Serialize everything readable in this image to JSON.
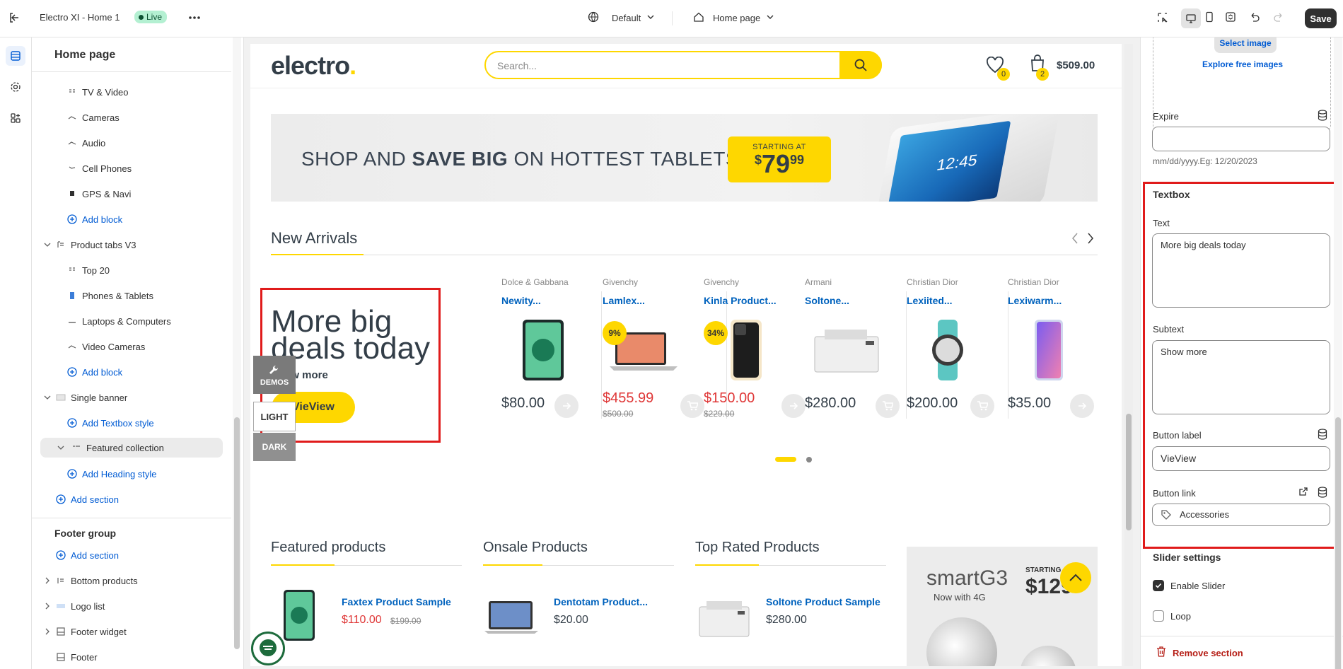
{
  "topbar": {
    "store_name": "Electro XI - Home 1",
    "status": "Live",
    "theme_select": "Default",
    "page_select": "Home page",
    "save_label": "Save"
  },
  "tree": {
    "title": "Home page",
    "items": [
      {
        "label": "TV & Video"
      },
      {
        "label": "Cameras"
      },
      {
        "label": "Audio"
      },
      {
        "label": "Cell Phones"
      },
      {
        "label": "GPS & Navi"
      },
      {
        "label": "Add block"
      },
      {
        "label": "Product tabs V3"
      },
      {
        "label": "Top 20"
      },
      {
        "label": "Phones & Tablets"
      },
      {
        "label": "Laptops & Computers"
      },
      {
        "label": "Video Cameras"
      },
      {
        "label": "Add block"
      },
      {
        "label": "Single banner"
      },
      {
        "label": "Add Textbox style"
      },
      {
        "label": "Featured collection"
      },
      {
        "label": "Add Heading style"
      },
      {
        "label": "Add section"
      }
    ],
    "footer_group": "Footer group",
    "footer_items": [
      {
        "label": "Add section"
      },
      {
        "label": "Bottom products"
      },
      {
        "label": "Logo list"
      },
      {
        "label": "Footer widget"
      },
      {
        "label": "Footer"
      }
    ]
  },
  "preview": {
    "logo": "electro",
    "logo_dot": ".",
    "search_placeholder": "Search...",
    "wishlist_count": "0",
    "cart_count": "2",
    "cart_total": "$509.00",
    "banner": {
      "text_pre": "SHOP AND ",
      "text_bold": "SAVE BIG",
      "text_post": " ON HOTTEST TABLETS",
      "starting_at": "STARTING AT",
      "price_cur": "$",
      "price_main": "79",
      "price_cents": "99",
      "tablet_time": "12:45"
    },
    "new_arrivals": "New Arrivals",
    "promo": {
      "text": "More big deals today",
      "subtext": "Show more",
      "button": "VieView"
    },
    "floaters": {
      "demos": "DEMOS",
      "light": "LIGHT",
      "dark": "DARK"
    },
    "products": [
      {
        "brand": "Dolce & Gabbana",
        "name": "Newity...",
        "price": "$80.00",
        "old": "",
        "discount": ""
      },
      {
        "brand": "Givenchy",
        "name": "Lamlex...",
        "price": "$455.99",
        "old": "$500.00",
        "discount": "9%"
      },
      {
        "brand": "Givenchy",
        "name": "Kinla Product...",
        "price": "$150.00",
        "old": "$229.00",
        "discount": "34%"
      },
      {
        "brand": "Armani",
        "name": "Soltone...",
        "price": "$280.00",
        "old": "",
        "discount": ""
      },
      {
        "brand": "Christian Dior",
        "name": "Lexiited...",
        "price": "$200.00",
        "old": "",
        "discount": ""
      },
      {
        "brand": "Christian Dior",
        "name": "Lexiwarm...",
        "price": "$35.00",
        "old": "",
        "discount": ""
      }
    ],
    "columns": [
      {
        "title": "Featured products",
        "item_name": "Faxtex Product Sample",
        "price": "$110.00",
        "old": "$199.00"
      },
      {
        "title": "Onsale Products",
        "item_name": "Dentotam Product...",
        "price": "$20.00",
        "old": ""
      },
      {
        "title": "Top Rated Products",
        "item_name": "Soltone Product Sample",
        "price": "$280.00",
        "old": ""
      }
    ],
    "smart_banner": {
      "title": "smartG3",
      "sub": "Now with 4G",
      "starting_at": "STARTING AT",
      "price": "$129"
    }
  },
  "settings": {
    "select_image": "Select image",
    "explore_images": "Explore free images",
    "expire_label": "Expire",
    "expire_value": "",
    "expire_hint": "mm/dd/yyyy.Eg: 12/20/2023",
    "textbox_heading": "Textbox",
    "text_label": "Text",
    "text_value": "More big deals today",
    "subtext_label": "Subtext",
    "subtext_value": "Show more",
    "button_label_label": "Button label",
    "button_label_value": "VieView",
    "button_link_label": "Button link",
    "button_link_value": "Accessories",
    "slider_heading": "Slider settings",
    "enable_slider": "Enable Slider",
    "enable_slider_checked": true,
    "loop": "Loop",
    "loop_checked": false,
    "remove_section": "Remove section"
  }
}
